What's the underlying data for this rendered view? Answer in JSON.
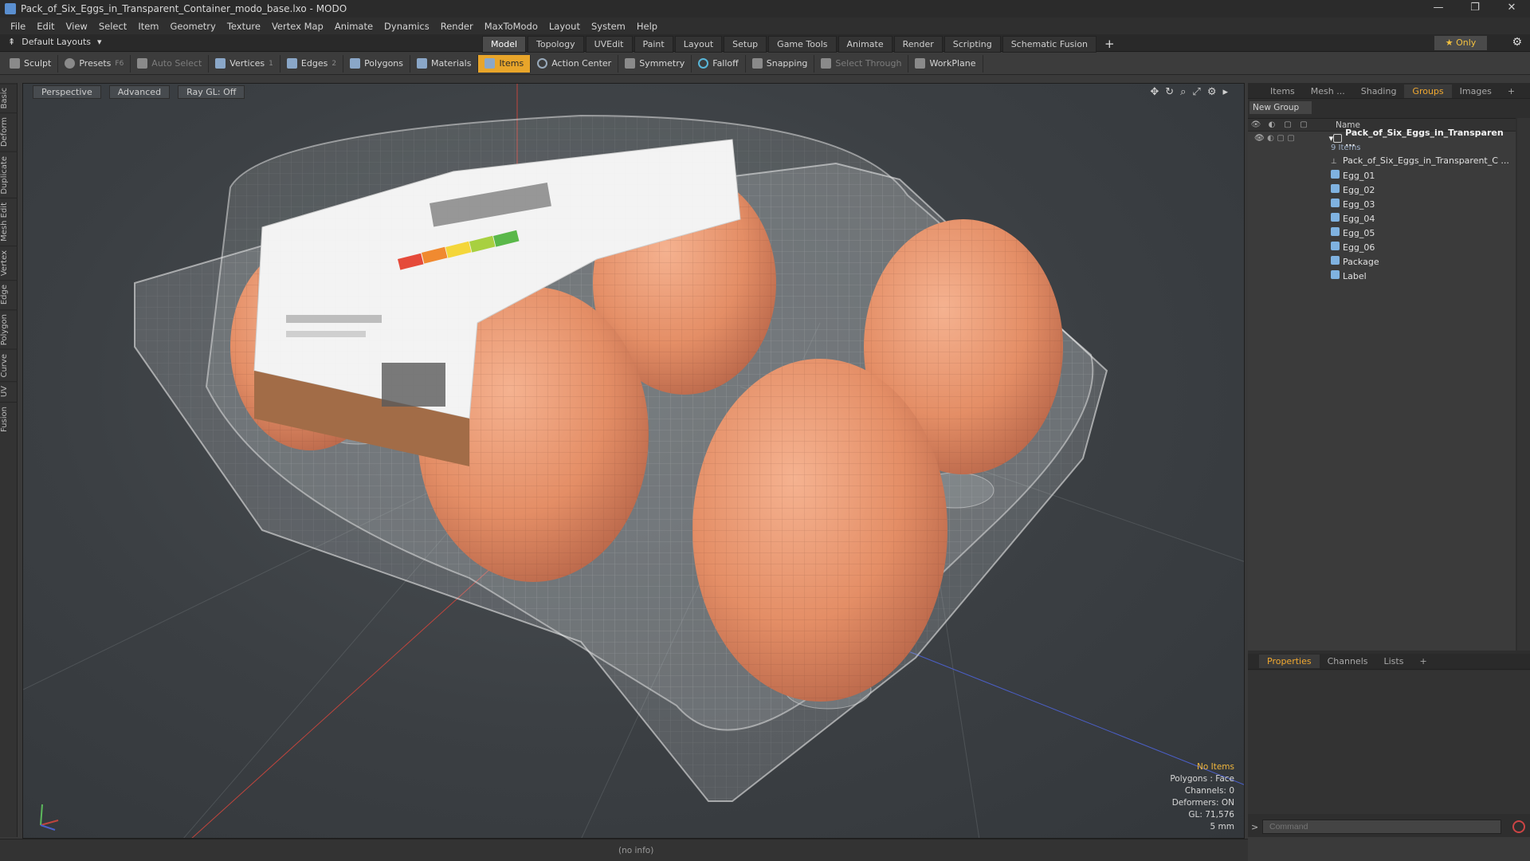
{
  "window": {
    "title": "Pack_of_Six_Eggs_in_Transparent_Container_modo_base.lxo - MODO",
    "controls": [
      "—",
      "❐",
      "✕"
    ]
  },
  "menu": [
    "File",
    "Edit",
    "View",
    "Select",
    "Item",
    "Geometry",
    "Texture",
    "Vertex Map",
    "Animate",
    "Dynamics",
    "Render",
    "MaxToModo",
    "Layout",
    "System",
    "Help"
  ],
  "layoutbar": {
    "layouts_label": "Default Layouts",
    "tabs": [
      "Model",
      "Topology",
      "UVEdit",
      "Paint",
      "Layout",
      "Setup",
      "Game Tools",
      "Animate",
      "Render",
      "Scripting",
      "Schematic Fusion"
    ],
    "active_tab": "Model",
    "only_label": "★ Only"
  },
  "toolbar": {
    "sculpt": "Sculpt",
    "presets": "Presets",
    "presets_key": "F6",
    "auto_select": "Auto Select",
    "vertices": "Vertices",
    "vertices_key": "1",
    "edges": "Edges",
    "edges_key": "2",
    "polygons": "Polygons",
    "materials": "Materials",
    "items": "Items",
    "action_center": "Action Center",
    "symmetry": "Symmetry",
    "falloff": "Falloff",
    "snapping": "Snapping",
    "select_through": "Select Through",
    "workplane": "WorkPlane"
  },
  "lefttabs": [
    "Basic",
    "Deform",
    "Duplicate",
    "Mesh Edit",
    "Vertex",
    "Edge",
    "Polygon",
    "Curve",
    "UV",
    "Fusion"
  ],
  "viewport": {
    "view_mode": "Perspective",
    "shading": "Advanced",
    "raygl": "Ray GL: Off",
    "stats": {
      "items": "No Items",
      "polygons": "Polygons : Face",
      "channels": "Channels: 0",
      "deformers": "Deformers: ON",
      "gl": "GL: 71,576",
      "scale": "5 mm"
    }
  },
  "rightpanel": {
    "tabs": [
      "Items",
      "Mesh ...",
      "Shading",
      "Groups",
      "Images",
      "+"
    ],
    "active_tab": "Groups",
    "new_group": "New Group",
    "column_name": "Name",
    "group_name": "Pack_of_Six_Eggs_in_Transparen ...",
    "group_count": "9 Items",
    "items": [
      "Pack_of_Six_Eggs_in_Transparent_C ...",
      "Egg_01",
      "Egg_02",
      "Egg_03",
      "Egg_04",
      "Egg_05",
      "Egg_06",
      "Package",
      "Label"
    ],
    "lower_tabs": [
      "Properties",
      "Channels",
      "Lists",
      "+"
    ],
    "lower_active": "Properties",
    "command_placeholder": "Command"
  },
  "status": {
    "info": "(no info)"
  },
  "colors": {
    "accent": "#e8a52a",
    "egg": "#e8946c",
    "viewport_bg": "#3e4246"
  }
}
